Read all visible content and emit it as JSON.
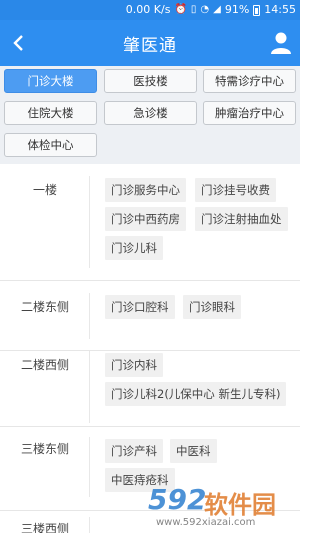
{
  "status_bar": {
    "speed": "0.00 K/s",
    "battery": "91%",
    "time": "14:55"
  },
  "app_bar": {
    "title": "肇医通"
  },
  "tabs": [
    {
      "label": "门诊大楼",
      "active": true
    },
    {
      "label": "医技楼",
      "active": false
    },
    {
      "label": "特需诊疗中心",
      "active": false
    },
    {
      "label": "住院大楼",
      "active": false
    },
    {
      "label": "急诊楼",
      "active": false
    },
    {
      "label": "肿瘤治疗中心",
      "active": false
    },
    {
      "label": "体检中心",
      "active": false
    }
  ],
  "floors": [
    {
      "label": "一楼",
      "departments": [
        "门诊服务中心",
        "门诊挂号收费",
        "门诊中西药房",
        "门诊注射抽血处",
        "门诊儿科"
      ]
    },
    {
      "label": "二楼东侧",
      "departments": [
        "门诊口腔科",
        "门诊眼科"
      ]
    },
    {
      "label": "二楼西侧",
      "departments": [
        "门诊内科",
        "门诊儿科2(儿保中心 新生儿专科)"
      ]
    },
    {
      "label": "三楼东侧",
      "departments": [
        "门诊产科",
        "中医科",
        "中医痔疮科"
      ]
    },
    {
      "label": "三楼西侧",
      "departments": []
    }
  ],
  "watermark": {
    "number": "592",
    "text": "软件园",
    "url": "www.592xiazai.com"
  },
  "colors": {
    "primary": "#2e8ef0",
    "status_bar": "#2a88e8",
    "active_tab": "#4d9cf2",
    "chip_bg": "#f0f0f0"
  }
}
